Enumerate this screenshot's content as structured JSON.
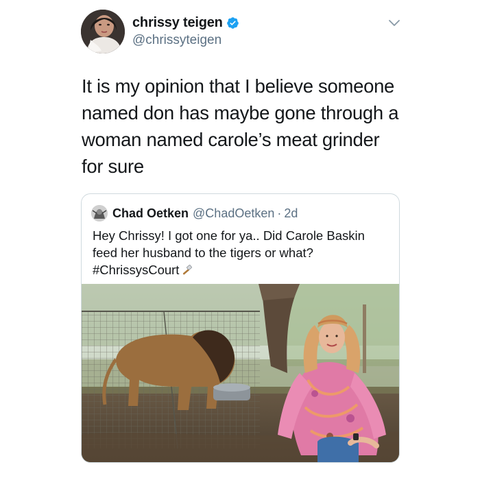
{
  "tweet": {
    "author": {
      "display_name": "chrissy teigen",
      "handle": "@chrissyteigen",
      "verified": true
    },
    "text": "It is my opinion that I believe someone named don has maybe gone through a woman named carole’s meat grinder for sure",
    "menu_icon": "chevron-down-icon"
  },
  "quote": {
    "author": {
      "display_name": "Chad Oetken",
      "handle": "@ChadOetken",
      "separator": "·",
      "time": "2d"
    },
    "text": "Hey Chrissy! I got one for ya.. Did Carole Baskin feed her husband to the tigers or what? #ChrissysCourt",
    "emoji": "hammer-icon",
    "media": {
      "description_icon": "photo-lion-and-woman"
    }
  },
  "colors": {
    "text_primary": "#14171a",
    "text_secondary": "#5b7083",
    "verified_blue": "#1da1f2",
    "card_border": "#cfd9de"
  }
}
